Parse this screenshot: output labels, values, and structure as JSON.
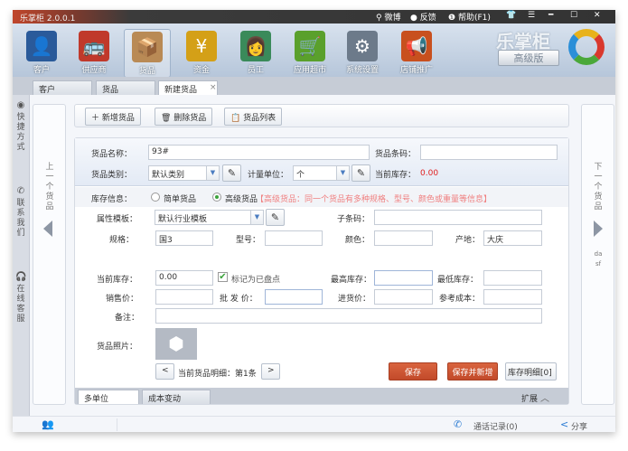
{
  "window": {
    "title": "乐掌柜 2.0.0.1",
    "weibo": "微博",
    "feedback": "反馈",
    "help": "帮助(F1)"
  },
  "toolbar": {
    "items": [
      {
        "label": "客户",
        "icon": "customer-icon",
        "color": "#2a5a9a",
        "glyph": "👤"
      },
      {
        "label": "供应商",
        "icon": "bus-icon",
        "color": "#c0392b",
        "glyph": "🚌"
      },
      {
        "label": "货品",
        "icon": "box-icon",
        "color": "#b98a55",
        "glyph": "📦"
      },
      {
        "label": "资金",
        "icon": "money-bag-icon",
        "color": "#d4a017",
        "glyph": "¥"
      },
      {
        "label": "员工",
        "icon": "staff-icon",
        "color": "#3a8a5a",
        "glyph": "👩"
      },
      {
        "label": "应用超市",
        "icon": "cart-icon",
        "color": "#5aa02c",
        "glyph": "🛒"
      },
      {
        "label": "系统设置",
        "icon": "gear-icon",
        "color": "#6c7a8a",
        "glyph": "⚙"
      },
      {
        "label": "店铺推广",
        "icon": "megaphone-icon",
        "color": "#c8501e",
        "glyph": "📢"
      }
    ],
    "active": "货品"
  },
  "brand": {
    "name": "乐掌柜",
    "edition": "高级版"
  },
  "tabs": [
    {
      "label": "客户"
    },
    {
      "label": "货品"
    },
    {
      "label": "新建货品",
      "close": "×"
    }
  ],
  "sidebar": {
    "items": [
      {
        "label": "快捷方式",
        "icon": "shortcut-icon"
      },
      {
        "label": "联系我们",
        "icon": "phone-icon"
      },
      {
        "label": "在线客服",
        "icon": "headset-icon"
      }
    ]
  },
  "nav": {
    "prev": "上一个货品",
    "next": "下一个货品",
    "next_extra": "dasf"
  },
  "actions": {
    "add": "新增货品",
    "delete": "删除货品",
    "list": "货品列表"
  },
  "form": {
    "name_label": "货品名称：",
    "name_value": "93#",
    "barcode_label": "货品条码：",
    "barcode_value": "",
    "category_label": "货品类别：",
    "category_value": "默认类别",
    "unit_label": "计量单位：",
    "unit_value": "个",
    "stock_label": "当前库存：",
    "stock_value": "0.00",
    "stock_info_label": "库存信息：",
    "simple_label": "简单货品",
    "advanced_label": "高级货品",
    "selected": "高级货品",
    "hint": "【高级货品：同一个货品有多种规格、型号、颜色或重量等信息】",
    "template_label": "属性模板：",
    "template_value": "默认行业模板",
    "subcode_label": "子条码：",
    "subcode_value": "",
    "spec_label": "规格：",
    "spec_value": "国3",
    "model_label": "型号：",
    "model_value": "",
    "color_label": "颜色：",
    "color_value": "",
    "origin_label": "产地：",
    "origin_value": "大庆",
    "cur_stock_label": "当前库存：",
    "cur_stock_value": "0.00",
    "checked_label": "标记为已盘点",
    "checked": true,
    "max_label": "最高库存：",
    "max_value": "",
    "min_label": "最低库存：",
    "min_value": "",
    "sale_label": "销售价：",
    "sale_value": "",
    "wholesale_label": "批 发 价：",
    "wholesale_value": "",
    "purchase_label": "进货价：",
    "purchase_value": "",
    "cost_label": "参考成本：",
    "cost_value": "",
    "note_label": "备注：",
    "note_value": "",
    "photo_label": "货品照片：",
    "detail_text": "当前货品明细：第1条",
    "save": "保存",
    "save_new": "保存并新增",
    "stock_detail": "库存明细[0]"
  },
  "bottom_tabs": [
    {
      "label": "多单位"
    },
    {
      "label": "成本变动"
    }
  ],
  "expand": "扩展",
  "status": {
    "calls": "通话记录(0)",
    "share": "分享"
  }
}
